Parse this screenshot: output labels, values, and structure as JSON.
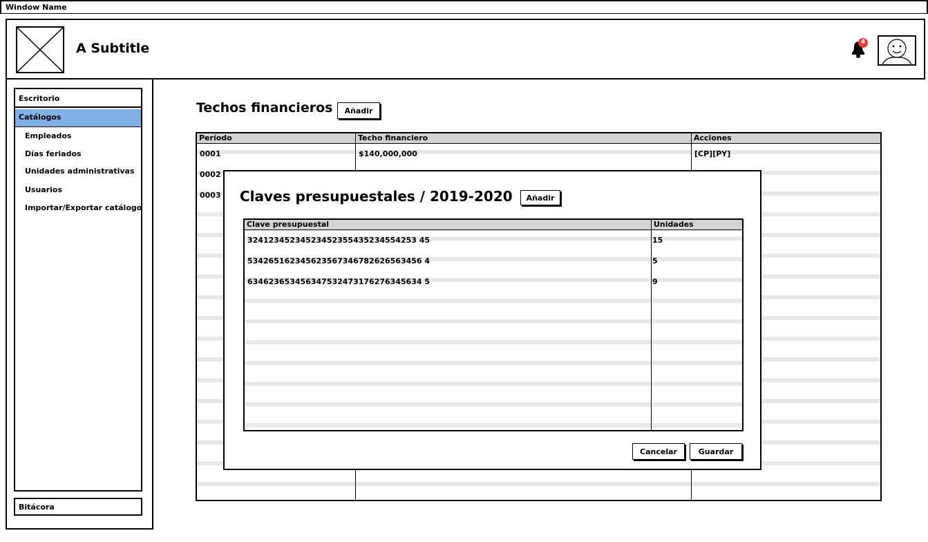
{
  "window": {
    "title": "Window Name"
  },
  "header": {
    "subtitle": "A Subtitle",
    "notification_count": "4"
  },
  "sidebar": {
    "top_item": "Escritorio",
    "selected_item": "Catálogos",
    "sub_items": [
      "Empleados",
      "Días feriados",
      "Unidades administrativas",
      "Usuarios",
      "Importar/Exportar catálogos"
    ],
    "bottom_item": "Bitácora"
  },
  "main": {
    "title": "Techos financieros",
    "add_label": "Añadir",
    "table": {
      "headers": [
        "Período",
        "Techo financiero",
        "Acciones"
      ],
      "rows": [
        [
          "0001",
          "$140,000,000",
          "[CP][PY]"
        ],
        [
          "0002",
          "",
          ""
        ],
        [
          "0003",
          "",
          ""
        ]
      ]
    }
  },
  "modal": {
    "title": "Claves presupuestales / 2019-2020",
    "add_label": "Añadir",
    "table": {
      "headers": [
        "Clave presupuestal",
        "Unidades"
      ],
      "rows": [
        [
          "32412345234523452355435234554253 45",
          "15"
        ],
        [
          "534265162345623567346782626563456 4",
          "5"
        ],
        [
          "634623653456347532473176276345634 5",
          "9"
        ]
      ]
    },
    "cancel_label": "Cancelar",
    "save_label": "Guardar"
  },
  "colors": {
    "selected": "#7fb0e6",
    "badge": "#e53935",
    "header_row": "#d3d3d3",
    "stripe": "#e8e8e8"
  }
}
